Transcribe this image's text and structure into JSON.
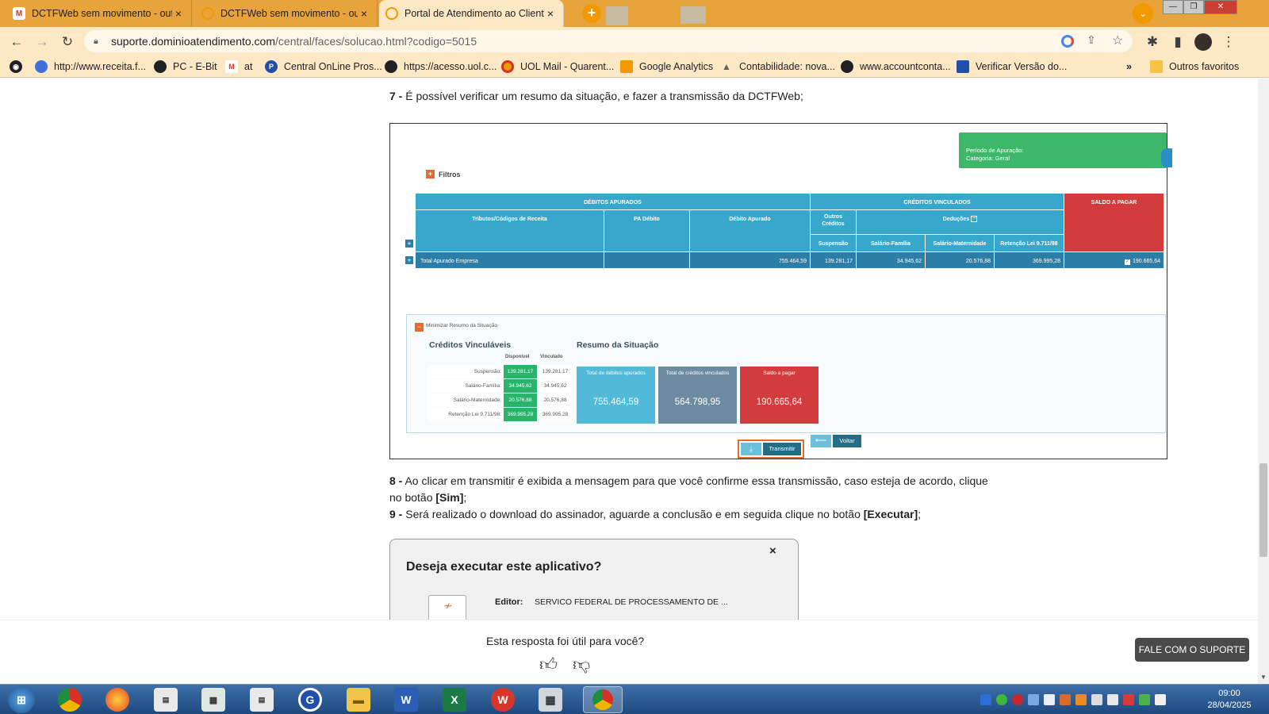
{
  "browser": {
    "tabs": [
      {
        "title": "DCTFWeb sem movimento - out/",
        "icon": "gmail-icon"
      },
      {
        "title": "DCTFWeb sem movimento - out/",
        "icon": "loading-icon"
      },
      {
        "title": "Portal de Atendimento ao Cliente",
        "icon": "portal-icon"
      }
    ],
    "new_tab": "+",
    "url_host": "suporte.dominioatendimento.com",
    "url_path": "/central/faces/solucao.html?codigo=5015",
    "bookmarks": [
      {
        "label": "http://www.receita.f...",
        "icon": "receita-icon"
      },
      {
        "label": "PC - E-Bit",
        "icon": "globe-icon"
      },
      {
        "label": "at",
        "icon": "gmail-icon"
      },
      {
        "label": "Central OnLine Pros...",
        "icon": "prosoft-icon"
      },
      {
        "label": "https://acesso.uol.c...",
        "icon": "globe-icon"
      },
      {
        "label": "UOL Mail - Quarent...",
        "icon": "uol-icon"
      },
      {
        "label": "Google Analytics",
        "icon": "analytics-icon"
      },
      {
        "label": "Contabilidade: nova...",
        "icon": "triangle-icon"
      },
      {
        "label": "www.accountconta...",
        "icon": "globe-icon"
      },
      {
        "label": "Verificar Versão do...",
        "icon": "version-icon"
      }
    ],
    "more_bookmarks": "»",
    "other_favorites": "Outros favoritos"
  },
  "article": {
    "step7_num": "7 -",
    "step7_text": " É possível verificar um resumo da situação, e fazer a transmissão da DCTFWeb;",
    "step8_num": "8 -",
    "step8_text_a": " Ao clicar em transmitir é exibida a mensagem para que você confirme essa transmissão, caso esteja de acordo, clique",
    "step8_text_b": "no botão ",
    "step8_bold": "[Sim]",
    "step8_end": ";",
    "step9_num": "9 -",
    "step9_text": " Será realizado o download do assinador, aguarde a conclusão e em seguida clique no botão ",
    "step9_bold": "[Executar]",
    "step9_end": ";"
  },
  "shot": {
    "periodo_line1": "Período de Apuração:",
    "periodo_line2": "Categoria: Geral",
    "filtros": "Filtros",
    "debitos_header": "DÉBITOS APURADOS",
    "creditos_header": "CRÉDITOS VINCULADOS",
    "saldo_header": "SALDO A PAGAR",
    "col_tributos": "Tributos/Códigos de Receita",
    "col_pa": "PA Débito",
    "col_debito": "Débito Apurado",
    "col_outros": "Outros Créditos",
    "col_deducoes": "Deduções",
    "col_suspensao": "Suspensão",
    "col_salfam": "Salário-Família",
    "col_salmat": "Salário-Maternidade",
    "col_retencao": "Retenção Lei 9.711/98",
    "total_label": "Total Apurado Empresa",
    "total_debito": "755.464,59",
    "total_suspensao": "139.281,17",
    "total_salfam": "34.945,62",
    "total_salmat": "20.576,88",
    "total_retencao": "369.995,28",
    "total_saldo": "190.665,64",
    "minimizar": "Minimizar Resumo da Situação",
    "creditos_vinc_title": "Créditos Vinculáveis",
    "resumo_title": "Resumo da Situação",
    "col_disponivel": "Disponível",
    "col_vinculado": "Vinculado",
    "cred_rows": [
      {
        "label": "Suspensão:",
        "disp": "139.281,17",
        "vinc": "139.281,17"
      },
      {
        "label": "Salário-Família:",
        "disp": "34.945,62",
        "vinc": "34.945,62"
      },
      {
        "label": "Salário-Maternidade:",
        "disp": "20.576,88",
        "vinc": "20.576,88"
      },
      {
        "label": "Retenção Lei 9.711/98:",
        "disp": "369.995,28",
        "vinc": "369.995,28"
      }
    ],
    "tile1_label": "Total de débitos apurados",
    "tile1_value": "755.464,59",
    "tile2_label": "Total de créditos vinculados",
    "tile2_value": "564.798,95",
    "tile3_label": "Saldo a pagar",
    "tile3_value": "190.665,64",
    "transmitir": "Transmitir",
    "voltar": "Voltar"
  },
  "dialog": {
    "title": "Deseja executar este aplicativo?",
    "close": "×",
    "editor_label": "Editor:",
    "editor_value": "SERVICO FEDERAL DE PROCESSAMENTO DE ..."
  },
  "feedback": {
    "question": "Esta resposta foi útil para você?",
    "support_button": "FALE COM O SUPORTE"
  },
  "taskbar": {
    "time": "09:00",
    "date": "28/04/2025"
  },
  "colors": {
    "tab_strip": "#e8a33a",
    "toolbar": "#fde8c6",
    "table_blue": "#37a7cc",
    "saldo_red": "#d23c3c",
    "green": "#3db86b"
  }
}
